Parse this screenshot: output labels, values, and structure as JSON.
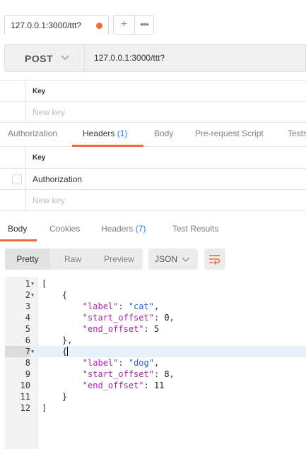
{
  "request_tab": {
    "label": "127.0.0.1:3000/ttt?",
    "unsaved_color": "#f26b3a"
  },
  "tab_actions": {
    "add": "+",
    "more": "•••"
  },
  "url_bar": {
    "method": "POST",
    "url": "127.0.0.1:3000/ttt?"
  },
  "params_table": {
    "header": "Key",
    "placeholder": "New key"
  },
  "request_tabs": [
    {
      "label": "Authorization",
      "count": ""
    },
    {
      "label": "Headers",
      "count": "(1)"
    },
    {
      "label": "Body",
      "count": ""
    },
    {
      "label": "Pre-request Script",
      "count": ""
    },
    {
      "label": "Tests",
      "count": ""
    }
  ],
  "headers_table": {
    "header": "Key",
    "rows": [
      "Authorization"
    ],
    "placeholder": "New key"
  },
  "response_tabs": [
    {
      "label": "Body",
      "count": ""
    },
    {
      "label": "Cookies",
      "count": ""
    },
    {
      "label": "Headers",
      "count": "(7)"
    },
    {
      "label": "Test Results",
      "count": ""
    }
  ],
  "view_modes": [
    "Pretty",
    "Raw",
    "Preview"
  ],
  "format": "JSON",
  "icons": {
    "method_dropdown": "chevron-down-icon",
    "format_dropdown": "chevron-down-icon",
    "wrap": "wrap-lines-icon"
  },
  "colors": {
    "accent": "#f26b3a",
    "count": "#2d7ed0",
    "json_key": "#a12a9e",
    "json_string": "#2d5fc4"
  },
  "code_lines": [
    "1",
    "2",
    "3",
    "4",
    "5",
    "6",
    "7",
    "8",
    "9",
    "10",
    "11",
    "12"
  ],
  "json": {
    "open_array": "[",
    "close_array": "]",
    "open_obj": "{",
    "close_obj": "}",
    "close_obj_comma": "},",
    "items": [
      {
        "label_key": "\"label\"",
        "label_val": "\"cat\"",
        "start_key": "\"start_offset\"",
        "start_val": "0",
        "end_key": "\"end_offset\"",
        "end_val": "5"
      },
      {
        "label_key": "\"label\"",
        "label_val": "\"dog\"",
        "start_key": "\"start_offset\"",
        "start_val": "8",
        "end_key": "\"end_offset\"",
        "end_val": "11"
      }
    ]
  }
}
